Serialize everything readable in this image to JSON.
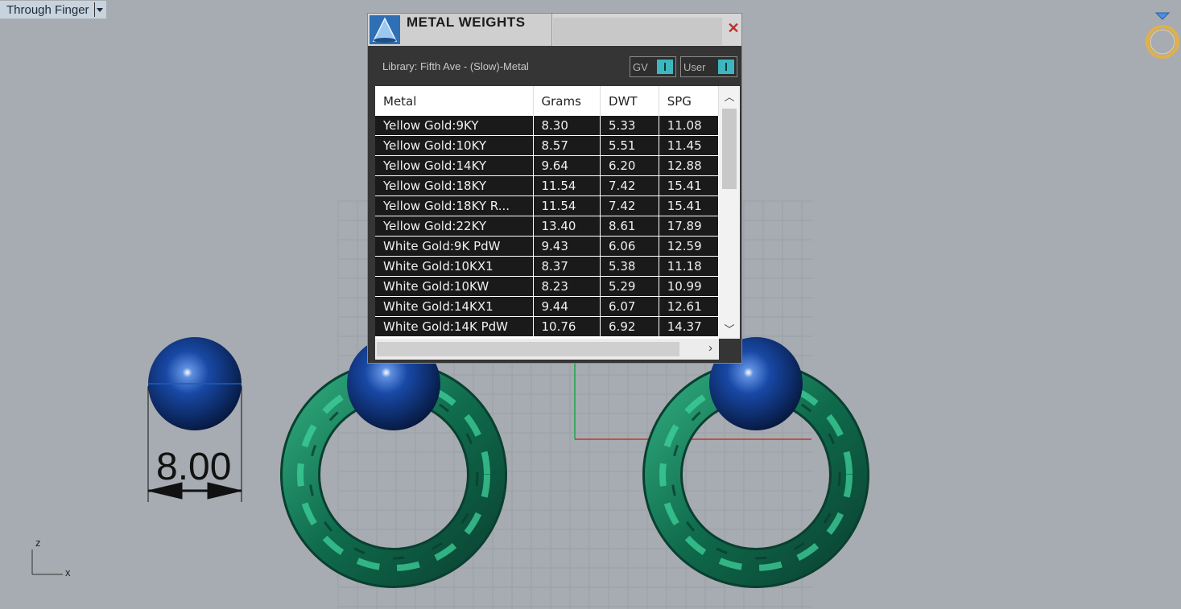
{
  "viewport": {
    "name": "Through Finger",
    "dimension_value": "8.00",
    "axis_labels": {
      "z": "z",
      "x": "x"
    }
  },
  "dialog": {
    "title": "METAL WEIGHTS",
    "close_glyph": "✕",
    "library_label": "Library: Fifth Ave - (Slow)-Metal",
    "toggles": [
      {
        "label": "GV"
      },
      {
        "label": "User"
      }
    ],
    "table": {
      "columns": [
        "Metal",
        "Grams",
        "DWT",
        "SPG"
      ],
      "rows": [
        [
          "Yellow Gold:9KY",
          "8.30",
          "5.33",
          "11.08"
        ],
        [
          "Yellow Gold:10KY",
          "8.57",
          "5.51",
          "11.45"
        ],
        [
          "Yellow Gold:14KY",
          "9.64",
          "6.20",
          "12.88"
        ],
        [
          "Yellow Gold:18KY",
          "11.54",
          "7.42",
          "15.41"
        ],
        [
          "Yellow Gold:18KY R...",
          "11.54",
          "7.42",
          "15.41"
        ],
        [
          "Yellow Gold:22KY",
          "13.40",
          "8.61",
          "17.89"
        ],
        [
          "White Gold:9K PdW",
          "9.43",
          "6.06",
          "12.59"
        ],
        [
          "White Gold:10KX1",
          "8.37",
          "5.38",
          "11.18"
        ],
        [
          "White Gold:10KW",
          "8.23",
          "5.29",
          "10.99"
        ],
        [
          "White Gold:14KX1",
          "9.44",
          "6.07",
          "12.61"
        ],
        [
          "White Gold:14K PdW",
          "10.76",
          "6.92",
          "14.37"
        ]
      ]
    }
  },
  "colors": {
    "viewport_bg": "#a7acb2",
    "sphere": "#0d3f8f",
    "rope": "#157a5a",
    "toggle_accent": "#3cb7c0"
  },
  "icons": [
    "logo-icon",
    "close-icon",
    "scroll-up-icon",
    "scroll-down-icon",
    "scroll-right-icon",
    "compass-ring-icon"
  ]
}
